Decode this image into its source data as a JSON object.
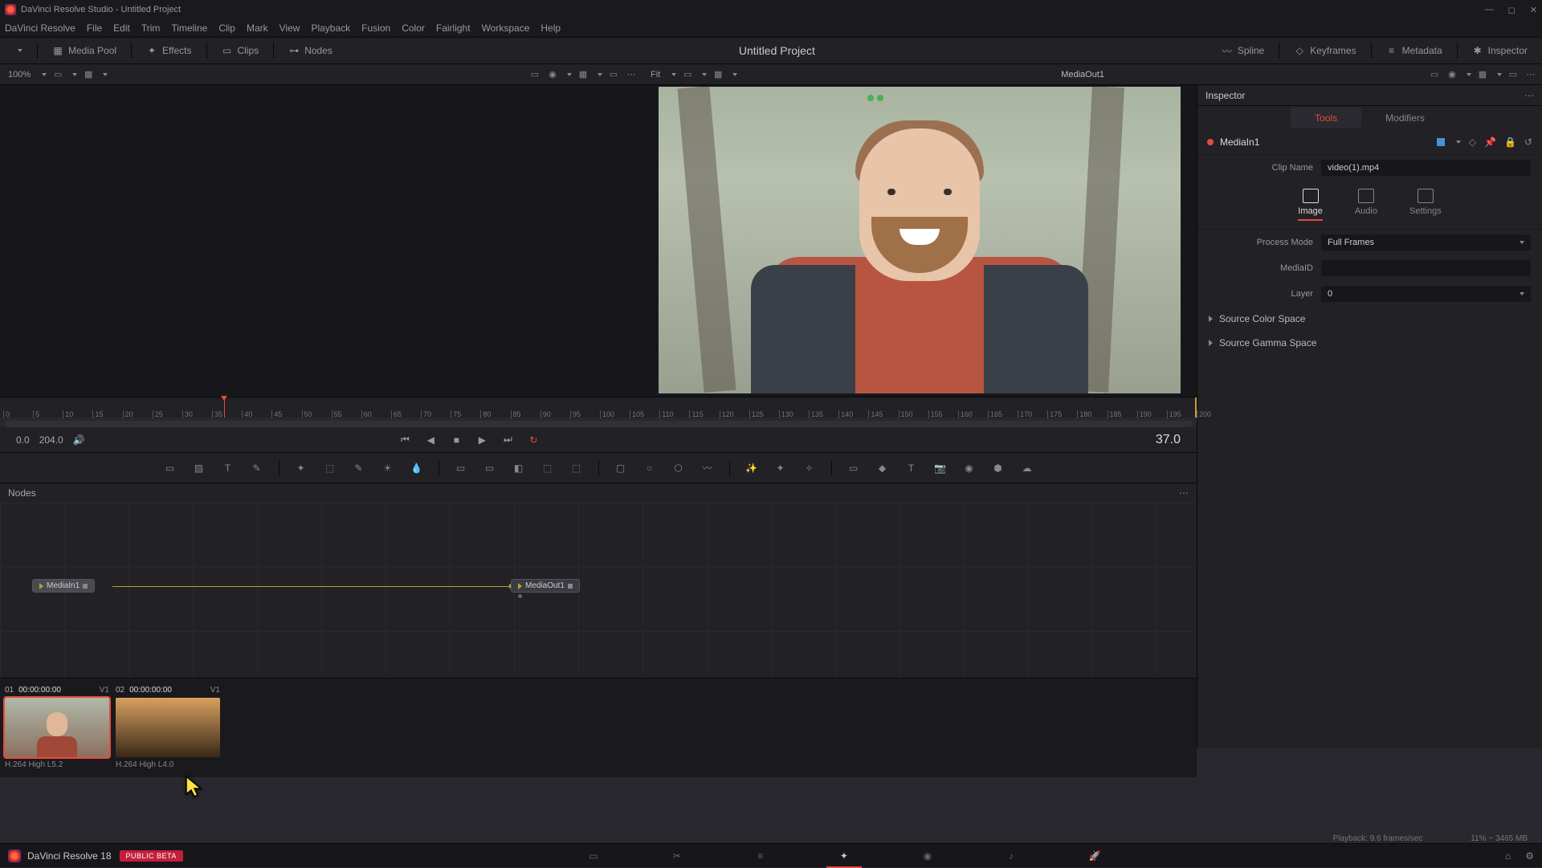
{
  "window": {
    "title": "DaVinci Resolve Studio - Untitled Project"
  },
  "menu": [
    "DaVinci Resolve",
    "File",
    "Edit",
    "Trim",
    "Timeline",
    "Clip",
    "Mark",
    "View",
    "Playback",
    "Fusion",
    "Color",
    "Fairlight",
    "Workspace",
    "Help"
  ],
  "toolbar": {
    "left": [
      {
        "name": "media-pool",
        "label": "Media Pool"
      },
      {
        "name": "effects",
        "label": "Effects"
      },
      {
        "name": "clips",
        "label": "Clips"
      },
      {
        "name": "nodes",
        "label": "Nodes"
      }
    ],
    "title": "Untitled Project",
    "right": [
      {
        "name": "spline",
        "label": "Spline"
      },
      {
        "name": "keyframes",
        "label": "Keyframes"
      },
      {
        "name": "metadata",
        "label": "Metadata"
      },
      {
        "name": "inspector",
        "label": "Inspector"
      }
    ]
  },
  "viewer": {
    "leftZoom": "100%",
    "rightZoom": "Fit",
    "rightLabel": "MediaOut1"
  },
  "ruler": {
    "ticks": [
      "0",
      "5",
      "10",
      "15",
      "20",
      "25",
      "30",
      "35",
      "40",
      "45",
      "50",
      "55",
      "60",
      "65",
      "70",
      "75",
      "80",
      "85",
      "90",
      "95",
      "100",
      "105",
      "110",
      "115",
      "120",
      "125",
      "130",
      "135",
      "140",
      "145",
      "150",
      "155",
      "160",
      "165",
      "170",
      "175",
      "180",
      "185",
      "190",
      "195",
      "200"
    ],
    "playhead": 37,
    "end": 204
  },
  "transport": {
    "in": "0.0",
    "out": "204.0",
    "current": "37.0"
  },
  "nodes": {
    "title": "Nodes",
    "in": "MediaIn1",
    "out": "MediaOut1"
  },
  "clips": [
    {
      "num": "01",
      "tc": "00:00:00:00",
      "track": "V1",
      "codec": "H.264 High L5.2",
      "selected": true,
      "thumb": "t1"
    },
    {
      "num": "02",
      "tc": "00:00:00:00",
      "track": "V1",
      "codec": "H.264 High L4.0",
      "selected": false,
      "thumb": "t2"
    }
  ],
  "inspector": {
    "title": "Inspector",
    "tabs": {
      "tools": "Tools",
      "modifiers": "Modifiers"
    },
    "nodeName": "MediaIn1",
    "clipNameLabel": "Clip Name",
    "clipName": "video(1).mp4",
    "cats": {
      "image": "Image",
      "audio": "Audio",
      "settings": "Settings"
    },
    "processModeLabel": "Process Mode",
    "processMode": "Full Frames",
    "mediaIDLabel": "MediaID",
    "mediaID": "",
    "layerLabel": "Layer",
    "layer": "0",
    "sourceColor": "Source Color Space",
    "sourceGamma": "Source Gamma Space"
  },
  "status": {
    "playback": "Playback: 9.6 frames/sec",
    "mem": "11% ~ 3465 MB"
  },
  "pagebar": {
    "name": "DaVinci Resolve 18",
    "badge": "PUBLIC BETA"
  }
}
